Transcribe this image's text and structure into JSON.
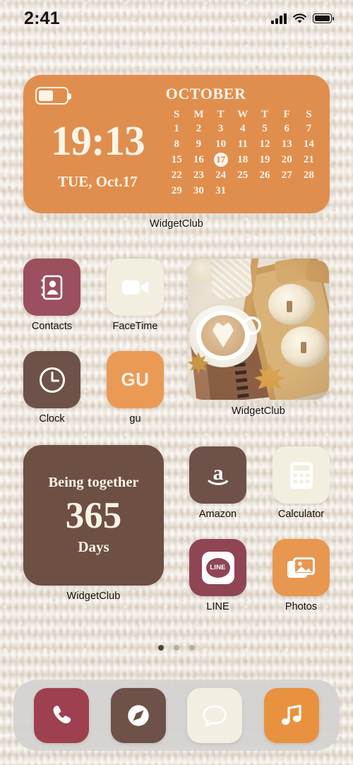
{
  "status_bar": {
    "time": "2:41",
    "signal_icon": "cellular-signal-icon",
    "wifi_icon": "wifi-icon",
    "battery_icon": "battery-icon"
  },
  "calendar_widget": {
    "label": "WidgetClub",
    "battery_icon": "battery-icon",
    "time": "19:13",
    "date": "TUE, Oct.17",
    "month": "OCTOBER",
    "weekdays": [
      "S",
      "M",
      "T",
      "W",
      "T",
      "F",
      "S"
    ],
    "leading_blanks": 0,
    "days": [
      1,
      2,
      3,
      4,
      5,
      6,
      7,
      8,
      9,
      10,
      11,
      12,
      13,
      14,
      15,
      16,
      17,
      18,
      19,
      20,
      21,
      22,
      23,
      24,
      25,
      26,
      27,
      28,
      29,
      30,
      31
    ],
    "today": 17,
    "bg_color": "#e08e4e",
    "text_color": "#fbf5e9"
  },
  "apps_row1": [
    {
      "name": "Contacts",
      "icon": "contacts-icon",
      "bg": "#9c4f5c"
    },
    {
      "name": "FaceTime",
      "icon": "facetime-icon",
      "bg": "#f2efe0"
    }
  ],
  "apps_row2": [
    {
      "name": "Clock",
      "icon": "clock-icon",
      "bg": "#6e5148"
    },
    {
      "name": "gu",
      "icon": "gu-text-icon",
      "bg": "#eb9a55",
      "glyph": "GU"
    }
  ],
  "photo_widget": {
    "label": "WidgetClub",
    "description": "autumn-latte-and-pumpkins-photo"
  },
  "together_widget": {
    "title": "Being together",
    "count": "365",
    "unit": "Days",
    "label": "WidgetClub",
    "bg_color": "#6e4f44"
  },
  "apps_right": [
    {
      "name": "Amazon",
      "icon": "amazon-icon",
      "bg": "#6e5148"
    },
    {
      "name": "Calculator",
      "icon": "calculator-icon",
      "bg": "#f2efe0"
    },
    {
      "name": "LINE",
      "icon": "line-icon",
      "bg": "#8f4554",
      "glyph": "LINE"
    },
    {
      "name": "Photos",
      "icon": "photos-icon",
      "bg": "#e89750"
    }
  ],
  "page_dots": {
    "count": 3,
    "active_index": 0
  },
  "dock": [
    {
      "name": "Phone",
      "icon": "phone-icon",
      "bg": "#9e404f"
    },
    {
      "name": "Safari",
      "icon": "safari-compass-icon",
      "bg": "#6e5148"
    },
    {
      "name": "Messages",
      "icon": "messages-bubble-icon",
      "bg": "#f2efe2"
    },
    {
      "name": "Music",
      "icon": "music-note-icon",
      "bg": "#e8923f"
    }
  ]
}
